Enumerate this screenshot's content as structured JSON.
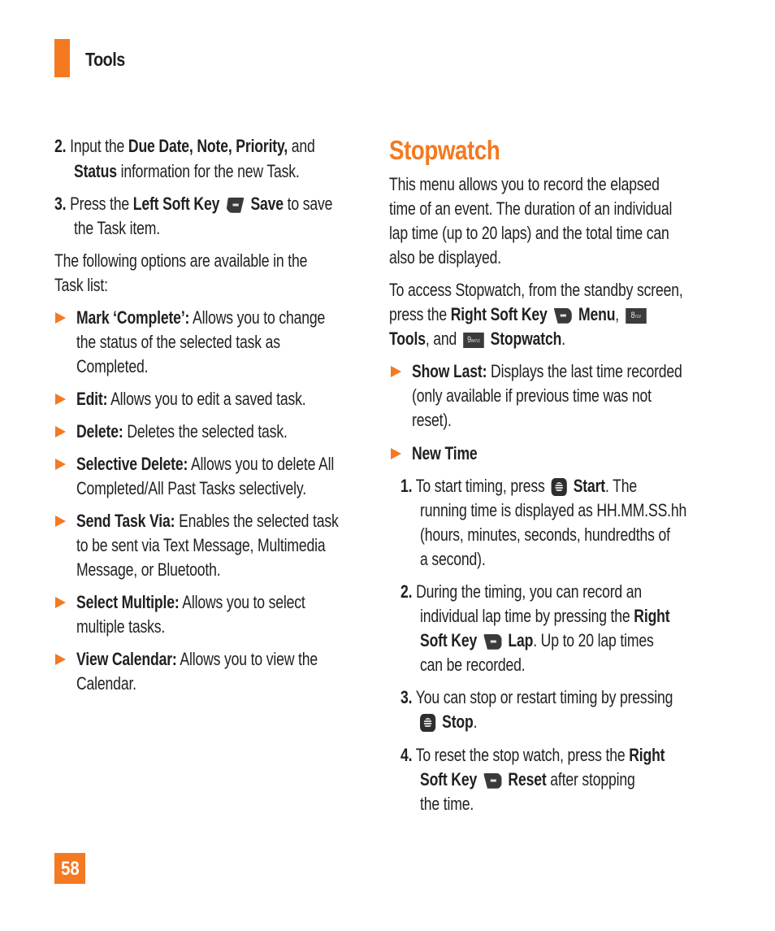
{
  "header": {
    "section": "Tools"
  },
  "left": {
    "steps": [
      {
        "num": "2.",
        "lines": [
          [
            {
              "t": "Input the ",
              "b": false
            },
            {
              "t": "Due Date, Note, Priority,",
              "b": true
            },
            {
              "t": " and",
              "b": false
            }
          ],
          [
            {
              "t": "Status",
              "b": true
            },
            {
              "t": " information for the new Task.",
              "b": false
            }
          ]
        ]
      },
      {
        "num": "3.",
        "lines": [
          [
            {
              "t": "Press the ",
              "b": false
            },
            {
              "t": "Left Soft Key",
              "b": true
            }
          ],
          [
            {
              "t": "the Task item.",
              "b": false
            }
          ]
        ],
        "after_icon": [
          {
            "t": "Save",
            "b": true
          },
          {
            "t": " to save",
            "b": false
          }
        ]
      }
    ],
    "intro": [
      "The following options are available in the",
      "Task list:"
    ],
    "bullets": [
      {
        "label": "Mark ‘Complete’:",
        "lines": [
          "Allows you to change",
          "the status of the selected task as",
          "Completed."
        ]
      },
      {
        "label": "Edit:",
        "lines": [
          "Allows you to edit a saved task."
        ]
      },
      {
        "label": "Delete:",
        "lines": [
          "Deletes the selected task."
        ]
      },
      {
        "label": "Selective Delete:",
        "lines": [
          "Allows you to delete All",
          "Completed/All Past Tasks selectively."
        ]
      },
      {
        "label": "Send Task Via:",
        "lines": [
          "Enables the selected task",
          "to be sent via Text Message, Multimedia",
          "Message, or Bluetooth."
        ]
      },
      {
        "label": "Select Multiple:",
        "lines": [
          "Allows you to select",
          "multiple tasks."
        ]
      },
      {
        "label": "View Calendar:",
        "lines": [
          "Allows you to view the",
          "Calendar."
        ]
      }
    ]
  },
  "right": {
    "heading": "Stopwatch",
    "intro": [
      "This menu allows you to record the elapsed",
      "time of an event. The duration of an individual",
      "lap time (up to 20 laps) and the total time can",
      "also be displayed."
    ],
    "access": {
      "line1": "To access Stopwatch, from the standby screen,",
      "press_the": "press the ",
      "rsk": "Right Soft Key",
      "menu": "Menu",
      "comma": ",",
      "key8": "8",
      "key8_sub": "TUV",
      "tools": "Tools",
      "and": ", and ",
      "key9": "9",
      "key9_sub": "WXYZ",
      "stopwatch": "Stopwatch",
      "period": "."
    },
    "show_last": {
      "label": "Show Last:",
      "lines": [
        "Displays the last time recorded",
        "(only available if previous time was not",
        "reset)."
      ]
    },
    "new_time": {
      "label": "New Time"
    },
    "steps": {
      "s1": {
        "num": "1.",
        "a": "To start timing, press ",
        "b": "Start",
        "c": ". The",
        "lines": [
          "running time is displayed as HH.MM.SS.hh",
          "(hours, minutes, seconds, hundredths of",
          "a second)."
        ]
      },
      "s2": {
        "num": "2.",
        "l1": "During the timing, you can record an",
        "l2a": "individual lap time by pressing the ",
        "l2b": "Right",
        "l3a": "Soft Key",
        "l3b": "Lap",
        "l3c": ". Up to 20 lap times",
        "l4": "can be recorded."
      },
      "s3": {
        "num": "3.",
        "l1": "You can stop or restart timing by pressing",
        "b": "Stop",
        "c": "."
      },
      "s4": {
        "num": "4.",
        "l1a": "To reset the stop watch, press the ",
        "l1b": "Right",
        "l2a": "Soft Key",
        "l2b": "Reset",
        "l2c": " after stopping",
        "l3": "the time."
      }
    }
  },
  "footer": {
    "page_number": "58"
  },
  "colors": {
    "accent": "#f47920",
    "text": "#231f20",
    "key": "#3a3a3a"
  }
}
